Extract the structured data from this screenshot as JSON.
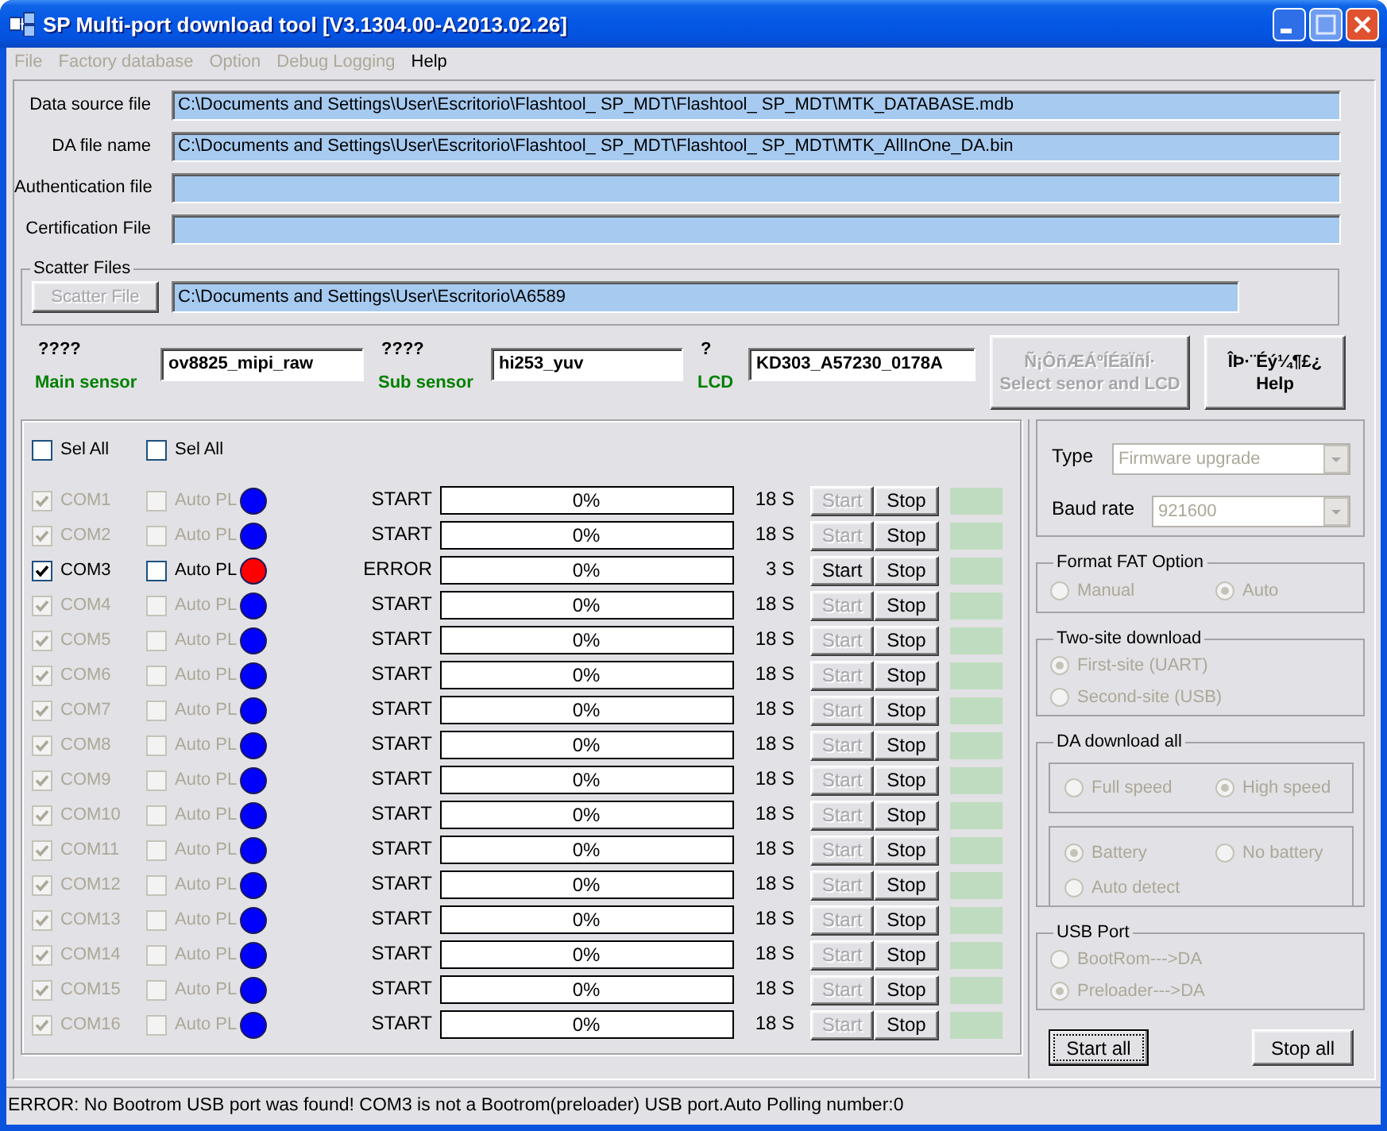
{
  "window": {
    "title": "SP Multi-port download tool [V3.1304.00-A2013.02.26]"
  },
  "menu": [
    {
      "label": "File",
      "disabled": true
    },
    {
      "label": "Factory database",
      "disabled": true
    },
    {
      "label": "Option",
      "disabled": true
    },
    {
      "label": "Debug Logging",
      "disabled": true
    },
    {
      "label": "Help",
      "disabled": false
    }
  ],
  "files": [
    {
      "label": "Data source file",
      "value": "C:\\Documents and Settings\\User\\Escritorio\\Flashtool_ SP_MDT\\Flashtool_ SP_MDT\\MTK_DATABASE.mdb"
    },
    {
      "label": "DA file name",
      "value": "C:\\Documents and Settings\\User\\Escritorio\\Flashtool_ SP_MDT\\Flashtool_ SP_MDT\\MTK_AllInOne_DA.bin"
    },
    {
      "label": "Authentication file"
    },
    {
      "label": "Certification File"
    }
  ],
  "scatter": {
    "title": "Scatter Files",
    "button": {
      "label": "Scatter File",
      "disabled": true
    },
    "value": "C:\\Documents and Settings\\User\\Escritorio\\A6589"
  },
  "sensors": [
    {
      "caption": "????",
      "label": "Main sensor",
      "value": "ov8825_mipi_raw"
    },
    {
      "caption": "????",
      "label": "Sub sensor",
      "value": "hi253_yuv"
    },
    {
      "caption": "?",
      "label": "LCD",
      "value": "KD303_A57230_0178A"
    }
  ],
  "sensor_buttons": [
    {
      "lines": [
        "Ñ¡ÔñÆÁºÍÉãÏñÍ·",
        "Select senor and LCD"
      ],
      "disabled": true
    },
    {
      "lines": [
        "ÎÞ·¨Éý¼¶£¿",
        "Help"
      ],
      "disabled": false
    }
  ],
  "ports": {
    "select_all": [
      {
        "label": "Sel All",
        "checked": false
      },
      {
        "label": "Sel All",
        "checked": false
      }
    ],
    "rows": [
      {
        "port": "COM1",
        "checked": true,
        "auto_label": "Auto PL",
        "auto_checked": false,
        "disabled": true,
        "color": "#0000ff",
        "status": "START",
        "progress": "0%",
        "level": 0,
        "time": "18 S",
        "start": "Start",
        "stop": "Stop"
      },
      {
        "port": "COM2",
        "checked": true,
        "auto_label": "Auto PL",
        "auto_checked": false,
        "disabled": true,
        "color": "#0000ff",
        "status": "START",
        "progress": "0%",
        "level": 0,
        "time": "18 S",
        "start": "Start",
        "stop": "Stop"
      },
      {
        "port": "COM3",
        "checked": true,
        "auto_label": "Auto PL",
        "auto_checked": false,
        "disabled": false,
        "color": "#ff0000",
        "status": "ERROR",
        "progress": "0%",
        "level": 0,
        "time": "3 S",
        "start": "Start",
        "stop": "Stop"
      },
      {
        "port": "COM4",
        "checked": true,
        "auto_label": "Auto PL",
        "auto_checked": false,
        "disabled": true,
        "color": "#0000ff",
        "status": "START",
        "progress": "0%",
        "level": 0,
        "time": "18 S",
        "start": "Start",
        "stop": "Stop"
      },
      {
        "port": "COM5",
        "checked": true,
        "auto_label": "Auto PL",
        "auto_checked": false,
        "disabled": true,
        "color": "#0000ff",
        "status": "START",
        "progress": "0%",
        "level": 0,
        "time": "18 S",
        "start": "Start",
        "stop": "Stop"
      },
      {
        "port": "COM6",
        "checked": true,
        "auto_label": "Auto PL",
        "auto_checked": false,
        "disabled": true,
        "color": "#0000ff",
        "status": "START",
        "progress": "0%",
        "level": 0,
        "time": "18 S",
        "start": "Start",
        "stop": "Stop"
      },
      {
        "port": "COM7",
        "checked": true,
        "auto_label": "Auto PL",
        "auto_checked": false,
        "disabled": true,
        "color": "#0000ff",
        "status": "START",
        "progress": "0%",
        "level": 0,
        "time": "18 S",
        "start": "Start",
        "stop": "Stop"
      },
      {
        "port": "COM8",
        "checked": true,
        "auto_label": "Auto PL",
        "auto_checked": false,
        "disabled": true,
        "color": "#0000ff",
        "status": "START",
        "progress": "0%",
        "level": 0,
        "time": "18 S",
        "start": "Start",
        "stop": "Stop"
      },
      {
        "port": "COM9",
        "checked": true,
        "auto_label": "Auto PL",
        "auto_checked": false,
        "disabled": true,
        "color": "#0000ff",
        "status": "START",
        "progress": "0%",
        "level": 0,
        "time": "18 S",
        "start": "Start",
        "stop": "Stop"
      },
      {
        "port": "COM10",
        "checked": true,
        "auto_label": "Auto PL",
        "auto_checked": false,
        "disabled": true,
        "color": "#0000ff",
        "status": "START",
        "progress": "0%",
        "level": 0,
        "time": "18 S",
        "start": "Start",
        "stop": "Stop"
      },
      {
        "port": "COM11",
        "checked": true,
        "auto_label": "Auto PL",
        "auto_checked": false,
        "disabled": true,
        "color": "#0000ff",
        "status": "START",
        "progress": "0%",
        "level": 0,
        "time": "18 S",
        "start": "Start",
        "stop": "Stop"
      },
      {
        "port": "COM12",
        "checked": true,
        "auto_label": "Auto PL",
        "auto_checked": false,
        "disabled": true,
        "color": "#0000ff",
        "status": "START",
        "progress": "0%",
        "level": 0,
        "time": "18 S",
        "start": "Start",
        "stop": "Stop"
      },
      {
        "port": "COM13",
        "checked": true,
        "auto_label": "Auto PL",
        "auto_checked": false,
        "disabled": true,
        "color": "#0000ff",
        "status": "START",
        "progress": "0%",
        "level": 0,
        "time": "18 S",
        "start": "Start",
        "stop": "Stop"
      },
      {
        "port": "COM14",
        "checked": true,
        "auto_label": "Auto PL",
        "auto_checked": false,
        "disabled": true,
        "color": "#0000ff",
        "status": "START",
        "progress": "0%",
        "level": 0,
        "time": "18 S",
        "start": "Start",
        "stop": "Stop"
      },
      {
        "port": "COM15",
        "checked": true,
        "auto_label": "Auto PL",
        "auto_checked": false,
        "disabled": true,
        "color": "#0000ff",
        "status": "START",
        "progress": "0%",
        "level": 0,
        "time": "18 S",
        "start": "Start",
        "stop": "Stop"
      },
      {
        "port": "COM16",
        "checked": true,
        "auto_label": "Auto PL",
        "auto_checked": false,
        "disabled": true,
        "color": "#0000ff",
        "status": "START",
        "progress": "0%",
        "level": 0,
        "time": "18 S",
        "start": "Start",
        "stop": "Stop"
      }
    ]
  },
  "settings": {
    "fields": [
      {
        "label": "Type",
        "value": "Firmware upgrade",
        "disabled": true
      },
      {
        "label": "Baud rate",
        "value": "921600",
        "disabled": true
      }
    ],
    "groups": [
      {
        "title": "Format FAT Option",
        "kind": "pair",
        "disabled": true,
        "options": [
          {
            "label": "Manual",
            "selected": false
          },
          {
            "label": "Auto",
            "selected": true
          }
        ]
      },
      {
        "title": "Two-site download",
        "kind": "stack",
        "disabled": true,
        "options": [
          {
            "label": "First-site (UART)",
            "selected": true
          },
          {
            "label": "Second-site (USB)",
            "selected": false
          }
        ]
      },
      {
        "title": "DA download all",
        "kind": "nested",
        "disabled": true,
        "sections": [
          {
            "options": [
              {
                "label": "Full speed",
                "selected": false
              },
              {
                "label": "High speed",
                "selected": true
              }
            ]
          },
          {
            "options": [
              {
                "label": "Battery",
                "selected": true
              },
              {
                "label": "No battery",
                "selected": false
              },
              {
                "label": "Auto detect",
                "selected": false
              }
            ]
          }
        ]
      },
      {
        "title": "USB Port",
        "kind": "stack",
        "disabled": true,
        "options": [
          {
            "label": "BootRom--->DA",
            "selected": false
          },
          {
            "label": "Preloader--->DA",
            "selected": true
          }
        ]
      }
    ]
  },
  "actions": [
    {
      "label": "Start all",
      "focused": true
    },
    {
      "label": "Stop all",
      "focused": false
    }
  ],
  "status_bar": "ERROR: No Bootrom USB port was found! COM3 is not a Bootrom(preloader) USB port.Auto Polling number:0"
}
